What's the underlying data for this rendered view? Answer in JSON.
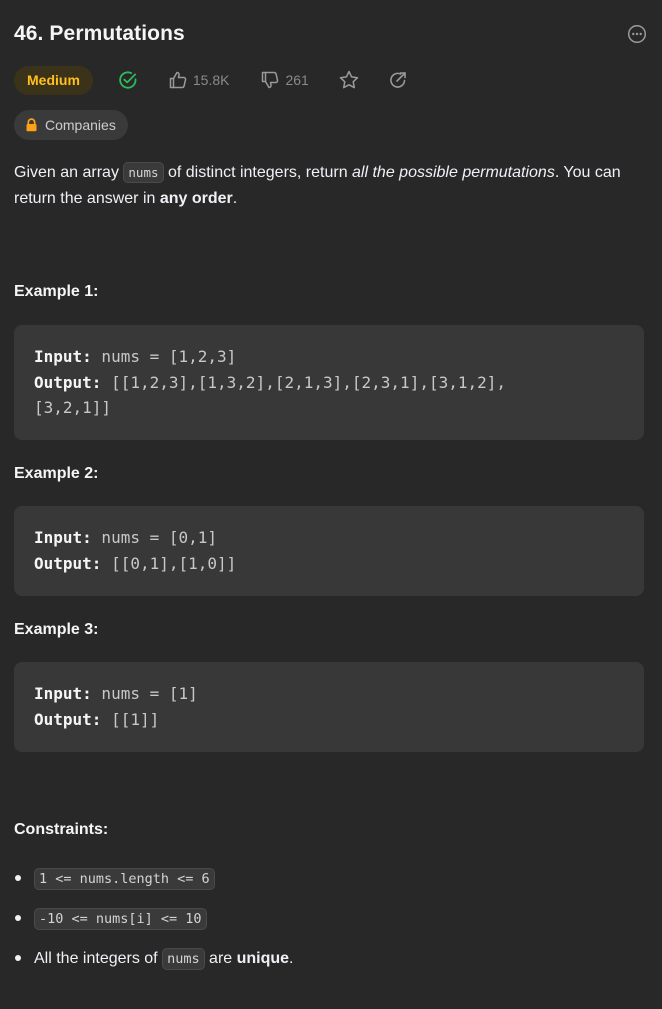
{
  "problem": {
    "title": "46. Permutations",
    "difficulty": "Medium",
    "likes": "15.8K",
    "dislikes": "261",
    "companies_label": "Companies"
  },
  "description": {
    "p1_a": "Given an array ",
    "p1_code": "nums",
    "p1_b": " of distinct integers, return ",
    "p1_em": "all the possible permutations",
    "p1_c": ". You can return the answer in ",
    "p1_strong": "any order",
    "p1_d": "."
  },
  "examples": [
    {
      "heading": "Example 1:",
      "input_label": "Input:",
      "input_value": " nums = [1,2,3]",
      "output_label": "Output:",
      "output_value_line1": " [[1,2,3],[1,3,2],[2,1,3],[2,3,1],[3,1,2],",
      "output_value_line2": "[3,2,1]]"
    },
    {
      "heading": "Example 2:",
      "input_label": "Input:",
      "input_value": " nums = [0,1]",
      "output_label": "Output:",
      "output_value": " [[0,1],[1,0]]"
    },
    {
      "heading": "Example 3:",
      "input_label": "Input:",
      "input_value": " nums = [1]",
      "output_label": "Output:",
      "output_value": " [[1]]"
    }
  ],
  "constraints": {
    "heading": "Constraints:",
    "c1_code": "1 <= nums.length <= 6",
    "c2_code": "-10 <= nums[i] <= 10",
    "c3_a": "All the integers of ",
    "c3_code": "nums",
    "c3_b": " are ",
    "c3_strong": "unique",
    "c3_c": "."
  },
  "colors": {
    "background": "#282828",
    "medium": "#ffc01e",
    "solved": "#2cbb5d",
    "code_bg": "#383838"
  },
  "icons": [
    "more-icon",
    "solved-check-icon",
    "thumbs-up-icon",
    "thumbs-down-icon",
    "star-icon",
    "share-icon",
    "lock-icon"
  ]
}
